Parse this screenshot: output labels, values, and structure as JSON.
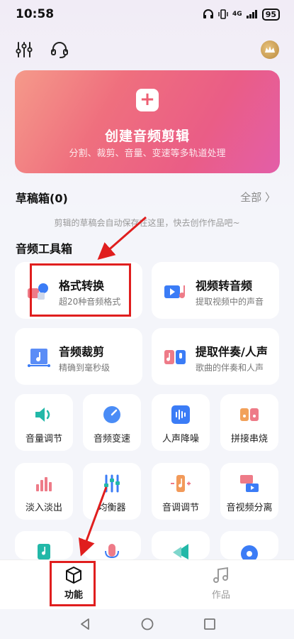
{
  "status_bar": {
    "time": "10:58",
    "network": "4G",
    "battery": "95"
  },
  "hero": {
    "title": "创建音频剪辑",
    "subtitle": "分割、裁剪、音量、变速等多轨道处理"
  },
  "drafts": {
    "title": "草稿箱(0)",
    "all_label": "全部 〉",
    "empty_text": "剪辑的草稿会自动保存在这里，快去创作作品吧~"
  },
  "toolbox": {
    "title": "音频工具箱",
    "big_cards": [
      {
        "title": "格式转换",
        "subtitle": "超20种音频格式",
        "icon": "format-convert-icon"
      },
      {
        "title": "视频转音频",
        "subtitle": "提取视频中的声音",
        "icon": "video-to-audio-icon"
      },
      {
        "title": "音频裁剪",
        "subtitle": "精确到毫秒级",
        "icon": "audio-trim-icon"
      },
      {
        "title": "提取伴奏/人声",
        "subtitle": "歌曲的伴奏和人声",
        "icon": "extract-accompaniment-icon"
      }
    ],
    "small_cards": [
      {
        "label": "音量调节",
        "icon": "volume-icon"
      },
      {
        "label": "音频变速",
        "icon": "speed-icon"
      },
      {
        "label": "人声降噪",
        "icon": "denoise-icon"
      },
      {
        "label": "拼接串烧",
        "icon": "splice-icon"
      },
      {
        "label": "淡入淡出",
        "icon": "fade-icon"
      },
      {
        "label": "均衡器",
        "icon": "equalizer-icon"
      },
      {
        "label": "音调调节",
        "icon": "pitch-icon"
      },
      {
        "label": "音视频分离",
        "icon": "av-separate-icon"
      }
    ]
  },
  "bottom_nav": {
    "items": [
      {
        "label": "功能",
        "active": true
      },
      {
        "label": "作品",
        "active": false
      }
    ]
  },
  "colors": {
    "accent": "#ee5f73",
    "annotation_red": "#e01e1e",
    "active_nav": "#111111",
    "inactive_nav": "#999999"
  }
}
